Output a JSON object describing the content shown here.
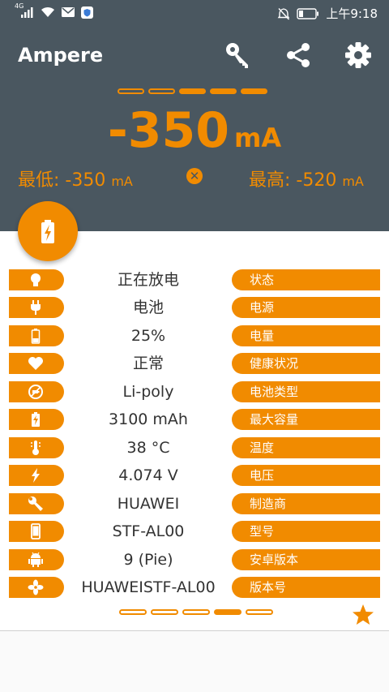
{
  "status_bar": {
    "network_label": "4G",
    "time": "上午9:18",
    "icons": [
      "signal-icon",
      "wifi-icon",
      "mail-icon",
      "shield-icon",
      "mute-icon",
      "battery-icon"
    ]
  },
  "header": {
    "app_title": "Ampere",
    "icons": [
      "key-icon",
      "share-icon",
      "gear-icon"
    ],
    "progress": [
      false,
      false,
      true,
      true,
      true
    ],
    "current_value": "-350",
    "current_unit": "mA",
    "min_label": "最低: -350",
    "min_unit": "mA",
    "max_label": "最高: -520",
    "max_unit": "mA",
    "reset_symbol": "✕"
  },
  "rows": [
    {
      "icon": "bulb-icon",
      "value": "正在放电",
      "label": "状态"
    },
    {
      "icon": "plug-icon",
      "value": "电池",
      "label": "电源"
    },
    {
      "icon": "battery-level-icon",
      "value": "25%",
      "label": "电量"
    },
    {
      "icon": "heart-icon",
      "value": "正常",
      "label": "健康状况"
    },
    {
      "icon": "battery-type-icon",
      "value": "Li-poly",
      "label": "电池类型"
    },
    {
      "icon": "battery-charge-icon",
      "value": "3100 mAh",
      "label": "最大容量"
    },
    {
      "icon": "thermometer-icon",
      "value": "38 °C",
      "label": "温度"
    },
    {
      "icon": "bolt-icon",
      "value": "4.074 V",
      "label": "电压"
    },
    {
      "icon": "wrench-icon",
      "value": "HUAWEI",
      "label": "制造商"
    },
    {
      "icon": "phone-icon",
      "value": "STF-AL00",
      "label": "型号"
    },
    {
      "icon": "android-icon",
      "value": "9 (Pie)",
      "label": "安卓版本"
    },
    {
      "icon": "fan-icon",
      "value": "HUAWEISTF-AL00",
      "label": "版本号"
    }
  ],
  "pager": [
    false,
    false,
    false,
    true,
    false
  ],
  "accent_color": "#f18b00",
  "header_color": "#4a5760"
}
